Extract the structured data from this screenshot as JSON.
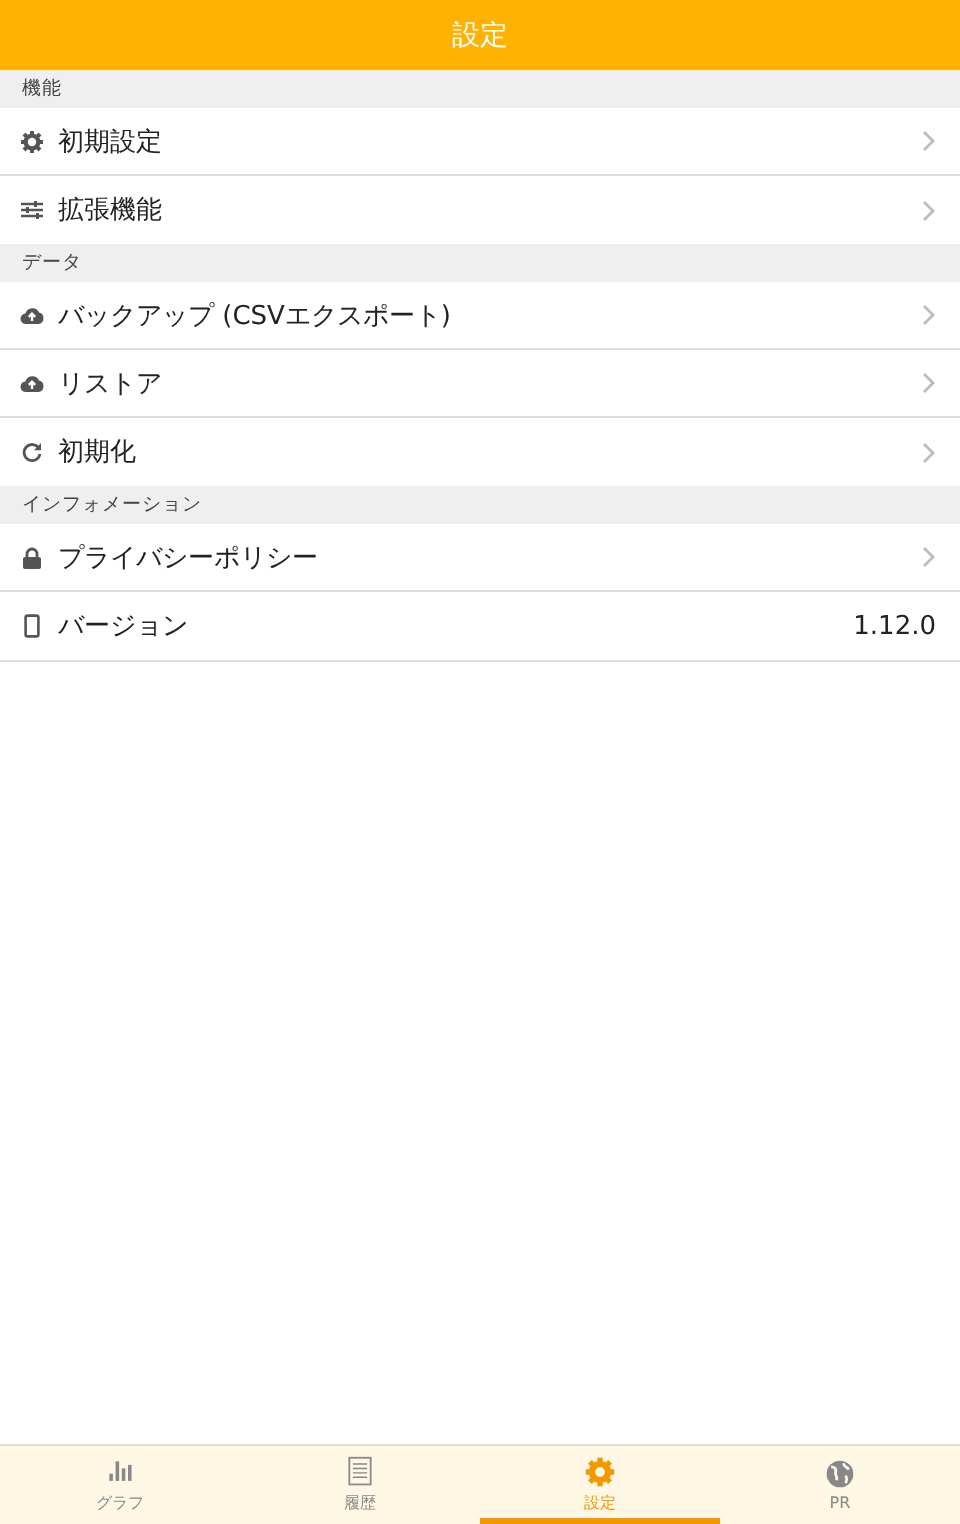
{
  "header": {
    "title": "設定"
  },
  "sections": [
    {
      "title": "機能",
      "items": [
        {
          "label": "初期設定",
          "kind": "link"
        },
        {
          "label": "拡張機能",
          "kind": "link"
        }
      ]
    },
    {
      "title": "データ",
      "items": [
        {
          "label": "バックアップ (CSVエクスポート)",
          "kind": "link"
        },
        {
          "label": "リストア",
          "kind": "link"
        },
        {
          "label": "初期化",
          "kind": "link"
        }
      ]
    },
    {
      "title": "インフォメーション",
      "items": [
        {
          "label": "プライバシーポリシー",
          "kind": "link"
        },
        {
          "label": "バージョン",
          "kind": "value",
          "value": "1.12.0"
        }
      ]
    }
  ],
  "tabs": [
    {
      "label": "グラフ",
      "selected": false
    },
    {
      "label": "履歴",
      "selected": false
    },
    {
      "label": "設定",
      "selected": true
    },
    {
      "label": "PR",
      "selected": false
    }
  ]
}
